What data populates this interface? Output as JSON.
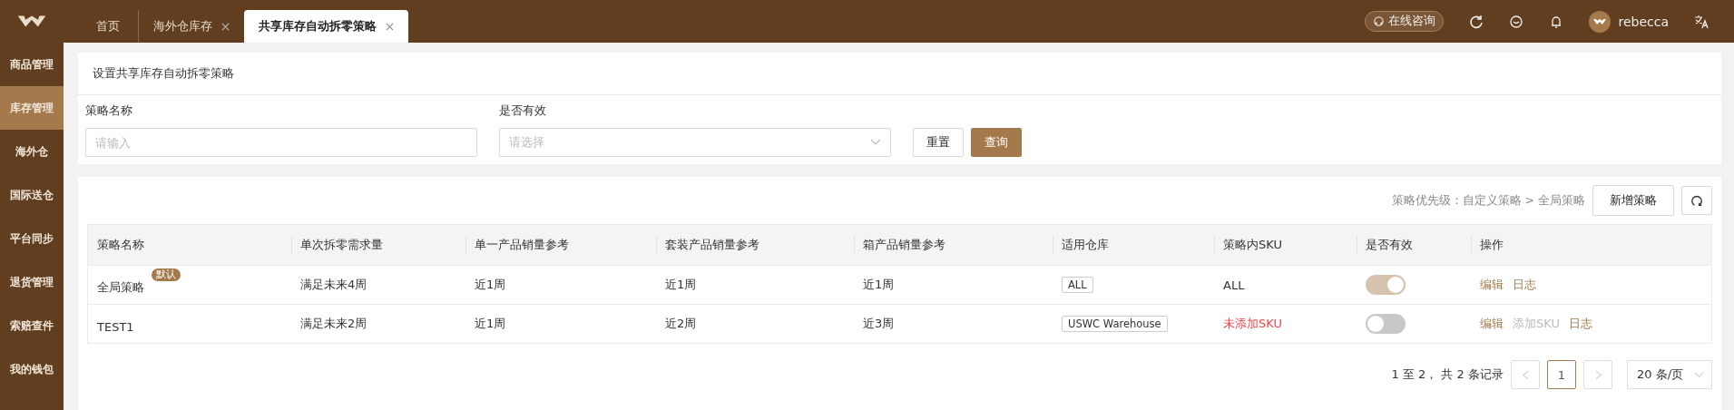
{
  "tabs": [
    {
      "label": "首页",
      "closable": false,
      "selected": false
    },
    {
      "label": "海外仓库存",
      "closable": true,
      "selected": false
    },
    {
      "label": "共享库存自动拆零策略",
      "closable": true,
      "selected": true
    }
  ],
  "header": {
    "consult": "在线咨询",
    "user": "rebecca"
  },
  "sidebar": {
    "items": [
      {
        "label": "商品管理",
        "selected": false
      },
      {
        "label": "库存管理",
        "selected": true
      },
      {
        "label": "海外仓",
        "selected": false
      },
      {
        "label": "国际送仓",
        "selected": false
      },
      {
        "label": "平台同步",
        "selected": false
      },
      {
        "label": "退货管理",
        "selected": false
      },
      {
        "label": "索赔查件",
        "selected": false
      },
      {
        "label": "我的钱包",
        "selected": false
      }
    ]
  },
  "filter": {
    "title": "设置共享库存自动拆零策略",
    "name_label": "策略名称",
    "name_placeholder": "请输入",
    "valid_label": "是否有效",
    "valid_placeholder": "请选择",
    "reset": "重置",
    "query": "查询"
  },
  "toolbar": {
    "priority": "策略优先级：自定义策略 > 全局策略",
    "add": "新增策略"
  },
  "table": {
    "columns": [
      "策略名称",
      "单次拆零需求量",
      "单一产品销量参考",
      "套装产品销量参考",
      "箱产品销量参考",
      "适用仓库",
      "策略内SKU",
      "是否有效",
      "操作"
    ],
    "rows": [
      {
        "name": "全局策略",
        "badge": "默认",
        "demand": "满足未来4周",
        "single": "近1周",
        "bundle": "近1周",
        "box": "近1周",
        "warehouse": "ALL",
        "sku": "ALL",
        "sku_missing": false,
        "on": true,
        "disabled": true,
        "actions": [
          {
            "label": "编辑",
            "disabled": false
          },
          {
            "label": "日志",
            "disabled": false
          }
        ]
      },
      {
        "name": "TEST1",
        "demand": "满足未来2周",
        "single": "近1周",
        "bundle": "近2周",
        "box": "近3周",
        "warehouse": "USWC Warehouse",
        "sku": "未添加SKU",
        "sku_missing": true,
        "on": false,
        "disabled": false,
        "actions": [
          {
            "label": "编辑",
            "disabled": false
          },
          {
            "label": "添加SKU",
            "disabled": true
          },
          {
            "label": "日志",
            "disabled": false
          }
        ]
      }
    ]
  },
  "pagination": {
    "summary": "1 至 2， 共 2 条记录",
    "pages": [
      {
        "label": "1",
        "selected": true
      }
    ],
    "page_size": "20 条/页"
  }
}
